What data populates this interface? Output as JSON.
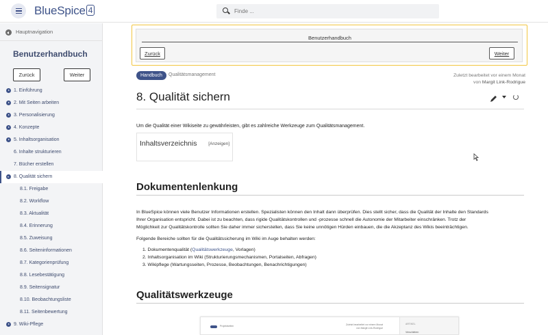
{
  "header": {
    "logo_text": "BlueSpice",
    "logo_version": "4",
    "search_placeholder": "Finde ..."
  },
  "sidebar": {
    "hauptnav_label": "Hauptnavigation",
    "title": "Benutzerhandbuch",
    "back_label": "Zurück",
    "next_label": "Weiter",
    "items": [
      {
        "label": "1. Einführung"
      },
      {
        "label": "2. Mit Seiten arbeiten"
      },
      {
        "label": "3. Personalisierung"
      },
      {
        "label": "4. Konzepte"
      },
      {
        "label": "5. Inhaltsorganisation"
      },
      {
        "label": "6. Inhalte strukturieren"
      },
      {
        "label": "7. Bücher erstellen"
      },
      {
        "label": "8. Qualität sichern"
      },
      {
        "label": "8.1. Freigabe"
      },
      {
        "label": "8.2. Workflow"
      },
      {
        "label": "8.3. Aktualität"
      },
      {
        "label": "8.4. Erinnerung"
      },
      {
        "label": "8.5. Zuweisung"
      },
      {
        "label": "8.6. Seiteninformationen"
      },
      {
        "label": "8.7. Kategorienprüfung"
      },
      {
        "label": "8.8. Lesebestätigung"
      },
      {
        "label": "8.9. Seitensignatur"
      },
      {
        "label": "8.10. Beobachtungsliste"
      },
      {
        "label": "8.11. Seitenbewertung"
      },
      {
        "label": "9. Wiki-Pflege"
      }
    ]
  },
  "bookbox": {
    "title": "Benutzerhandbuch",
    "back_label": "Zurück",
    "next_label": "Weiter"
  },
  "page": {
    "badge": "Handbuch",
    "breadcrumb": "Qualitätsmanagement",
    "last_edit_line1": "Zuletzt bearbeitet vor einem Monat",
    "last_edit_prefix": "von ",
    "last_edit_user": "Margit Link-Rodrigue",
    "title": "8. Qualität sichern",
    "intro": "Um die Qualität einer Wikiseite zu gewährleisten, gibt es zahlreiche Werkzeuge zum Qualitätsmanagement.",
    "toc_title": "Inhaltsverzeichnis",
    "toc_toggle": "[Anzeigen]",
    "section1_title": "Dokumentenlenkung",
    "section1_para1_line1": "In BlueSpice können viele Benutzer Informationen erstellen. Spezialisten können den Inhalt dann überprüfen. Dies stellt sicher, dass die Qualität der Inhalte den Standards",
    "section1_para1_line2": "Ihrer Organisation entspricht. Dabei ist zu beachten, dass rigide Qualitätskontrollen und -prozesse schnell die Autonomie der Mitarbeiter einschränken. Trotz der",
    "section1_para1_line3": "Möglichkeit zur Qualitätskontrolle sollten Sie daher immer sicherstellen, dass Sie keine unnötigen Hürden einbauen, die die Akzeptanz des Wikis beeinträchtigen.",
    "section1_para2": "Folgende Bereiche sollten für die Qualitätssicherung im Wiki im Auge behalten werden:",
    "list": {
      "item1_prefix": "1. Dokumentenqualität (",
      "item1_link": "Qualitätswerkzeuge",
      "item1_suffix": ", Vorlagen)",
      "item2": "2. Inhaltsorganisation im Wiki (Strukturierungsmechanismen, Portalseiten, Abfragen)",
      "item3": "3. Wikipflege (Wartungsseiten, Prozesse, Beobachtungen, Benachrichtigungen)"
    },
    "section2_title": "Qualitätswerkzeuge",
    "embed": {
      "crumb": "Projektseiten",
      "right_line1": "Zuletzt bearbeitet vor einem Monat",
      "right_line2": "von Margit Link-Rodrigue",
      "side_label": "ARTIKEL",
      "side_item": "Verschieben"
    }
  }
}
